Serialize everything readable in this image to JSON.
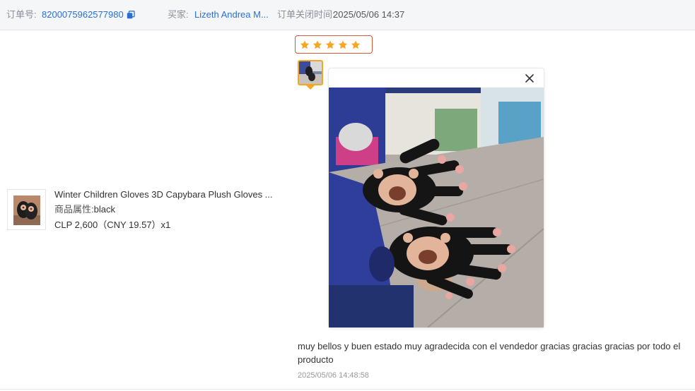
{
  "order": {
    "order_no_label": "订单号:",
    "order_no": "8200075962577980",
    "buyer_label": "买家:",
    "buyer_name": "Lizeth Andrea M...",
    "closed_time_label": "订单关闭时间:",
    "closed_time": "2025/05/06 14:37"
  },
  "product": {
    "title": "Winter Children Gloves 3D Capybara Plush Gloves ...",
    "attr_label": "商品属性:",
    "attr_value": "black",
    "price": "CLP 2,600（CNY  19.57）x1"
  },
  "review": {
    "rating": 5,
    "rating_max": 5,
    "star_color": "#f5a623",
    "comment": "muy bellos y buen estado muy agradecida con el vendedor gracias gracias gracias por todo el producto",
    "time": "2025/05/06 14:48:58"
  },
  "colors": {
    "link": "#2b6fd6",
    "rating_border": "#d9583a",
    "thumb_border": "#f5a623"
  },
  "icons": [
    "copy-icon",
    "star-icon",
    "close-icon"
  ]
}
